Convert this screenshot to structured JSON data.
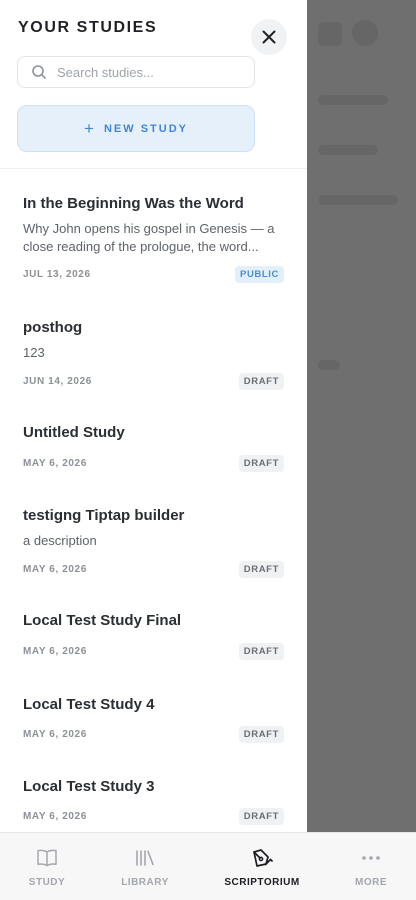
{
  "drawer": {
    "title": "YOUR STUDIES",
    "close_icon": "close-icon",
    "search": {
      "placeholder": "Search studies...",
      "value": ""
    },
    "new_study": {
      "plus": "+",
      "label": "NEW STUDY"
    }
  },
  "studies": [
    {
      "title": "In the Beginning Was the Word",
      "description": "Why John opens his gospel in Genesis — a close reading of the prologue, the word...",
      "date": "JUL 13, 2026",
      "status": "PUBLIC"
    },
    {
      "title": "posthog",
      "description": "123",
      "date": "JUN 14, 2026",
      "status": "DRAFT"
    },
    {
      "title": "Untitled Study",
      "description": "",
      "date": "MAY 6, 2026",
      "status": "DRAFT"
    },
    {
      "title": "testigng Tiptap builder",
      "description": "a description",
      "date": "MAY 6, 2026",
      "status": "DRAFT"
    },
    {
      "title": "Local Test Study Final",
      "description": "",
      "date": "MAY 6, 2026",
      "status": "DRAFT"
    },
    {
      "title": "Local Test Study 4",
      "description": "",
      "date": "MAY 6, 2026",
      "status": "DRAFT"
    },
    {
      "title": "Local Test Study 3",
      "description": "",
      "date": "MAY 6, 2026",
      "status": "DRAFT"
    }
  ],
  "bottom_nav": {
    "items": [
      {
        "label": "STUDY",
        "icon": "book-icon",
        "active": false
      },
      {
        "label": "LIBRARY",
        "icon": "library-icon",
        "active": false
      },
      {
        "label": "SCRIPTORIUM",
        "icon": "pen-nib-icon",
        "active": true
      },
      {
        "label": "MORE",
        "icon": "more-dots-icon",
        "active": false
      }
    ]
  },
  "colors": {
    "accent": "#3f86d4",
    "scrim": "#6f6f70",
    "text_primary": "#2b2e34"
  }
}
